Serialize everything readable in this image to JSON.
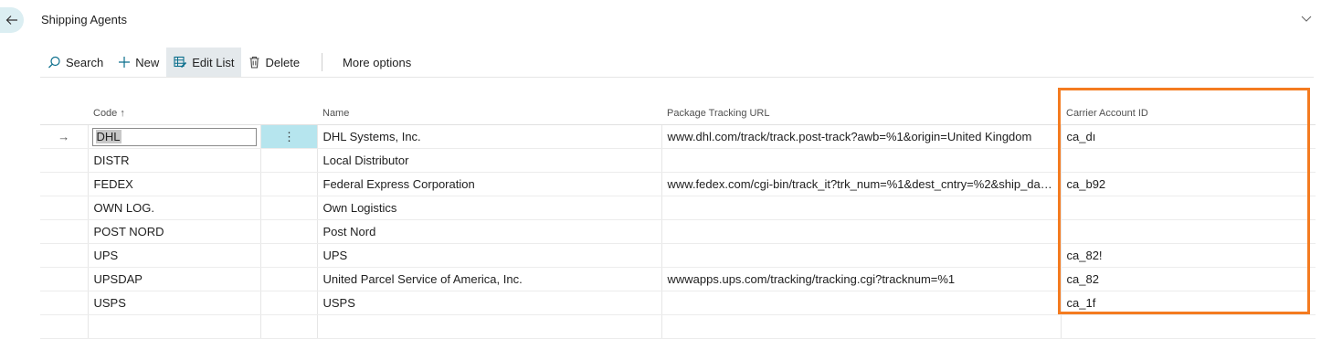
{
  "header": {
    "title": "Shipping Agents",
    "back_icon": "arrow-left-icon",
    "collapse_icon": "chevron-down-icon"
  },
  "toolbar": {
    "search_label": "Search",
    "new_label": "New",
    "edit_list_label": "Edit List",
    "delete_label": "Delete",
    "more_options_label": "More options"
  },
  "columns": {
    "code": "Code",
    "code_sort_icon": "↑",
    "name": "Name",
    "url": "Package Tracking URL",
    "carrier": "Carrier Account ID"
  },
  "rows": [
    {
      "code": "DHL",
      "name": "DHL Systems, Inc.",
      "url": "www.dhl.com/track/track.post-track?awb=%1&origin=United Kingdom",
      "carrier": "ca_dı",
      "selected": true
    },
    {
      "code": "DISTR",
      "name": "Local Distributor",
      "url": "",
      "carrier": ""
    },
    {
      "code": "FEDEX",
      "name": "Federal Express Corporation",
      "url": "www.fedex.com/cgi-bin/track_it?trk_num=%1&dest_cntry=%2&ship_date...",
      "carrier": "ca_b92"
    },
    {
      "code": "OWN LOG.",
      "name": "Own Logistics",
      "url": "",
      "carrier": ""
    },
    {
      "code": "POST NORD",
      "name": "Post Nord",
      "url": "",
      "carrier": ""
    },
    {
      "code": "UPS",
      "name": "UPS",
      "url": "",
      "carrier": "ca_82!"
    },
    {
      "code": "UPSDAP",
      "name": "United Parcel Service of America, Inc.",
      "url": "wwwapps.ups.com/tracking/tracking.cgi?tracknum=%1",
      "carrier": "ca_82"
    },
    {
      "code": "USPS",
      "name": "USPS",
      "url": "",
      "carrier": "ca_1f"
    }
  ],
  "row_indicator": "→",
  "row_menu": "⋮",
  "colors": {
    "highlight": "#f47b20",
    "selected_menu_cell": "#b6e5ee",
    "active_toolbar": "#e4e9ec",
    "accent": "#0a6e8c"
  }
}
